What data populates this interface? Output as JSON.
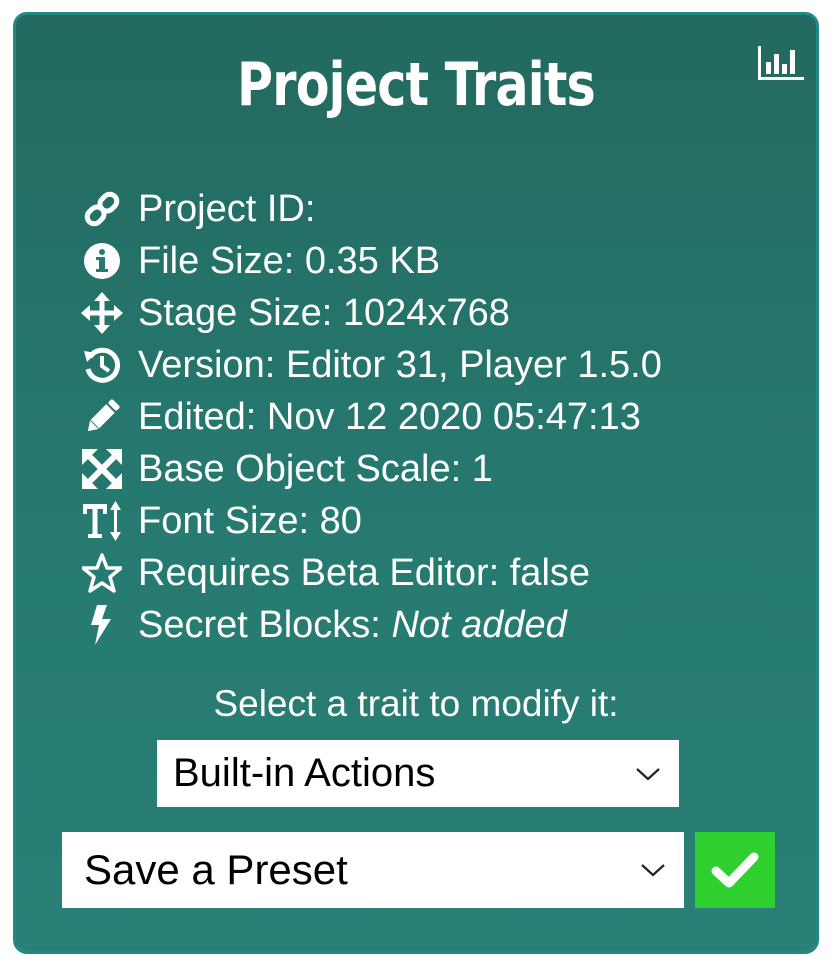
{
  "panel": {
    "title": "Project Traits",
    "stats_icon": "bar-chart-icon"
  },
  "info": [
    {
      "icon": "link-icon",
      "label": "Project ID:",
      "value": ""
    },
    {
      "icon": "info-circle-icon",
      "label": "File Size:",
      "value": "0.35 KB"
    },
    {
      "icon": "move-arrows-icon",
      "label": "Stage Size:",
      "value": "1024x768"
    },
    {
      "icon": "history-icon",
      "label": "Version:",
      "value": "Editor 31, Player 1.5.0"
    },
    {
      "icon": "pencil-icon",
      "label": "Edited:",
      "value": "Nov 12 2020 05:47:13"
    },
    {
      "icon": "expand-icon",
      "label": "Base Object Scale:",
      "value": "1"
    },
    {
      "icon": "text-height-icon",
      "label": "Font Size:",
      "value": "80"
    },
    {
      "icon": "star-outline-icon",
      "label": "Requires Beta Editor:",
      "value": "false"
    },
    {
      "icon": "bolt-icon",
      "label": "Secret Blocks:",
      "value": "Not added"
    }
  ],
  "controls": {
    "prompt": "Select a trait to modify it:",
    "trait_select": "Built-in Actions",
    "preset_select": "Save a Preset",
    "apply_icon": "checkmark-icon"
  },
  "colors": {
    "panel_top": "#23695f",
    "panel_bottom": "#2a8076",
    "border": "#1f8a84",
    "apply_button": "#2fcf2f",
    "text": "#ffffff"
  }
}
